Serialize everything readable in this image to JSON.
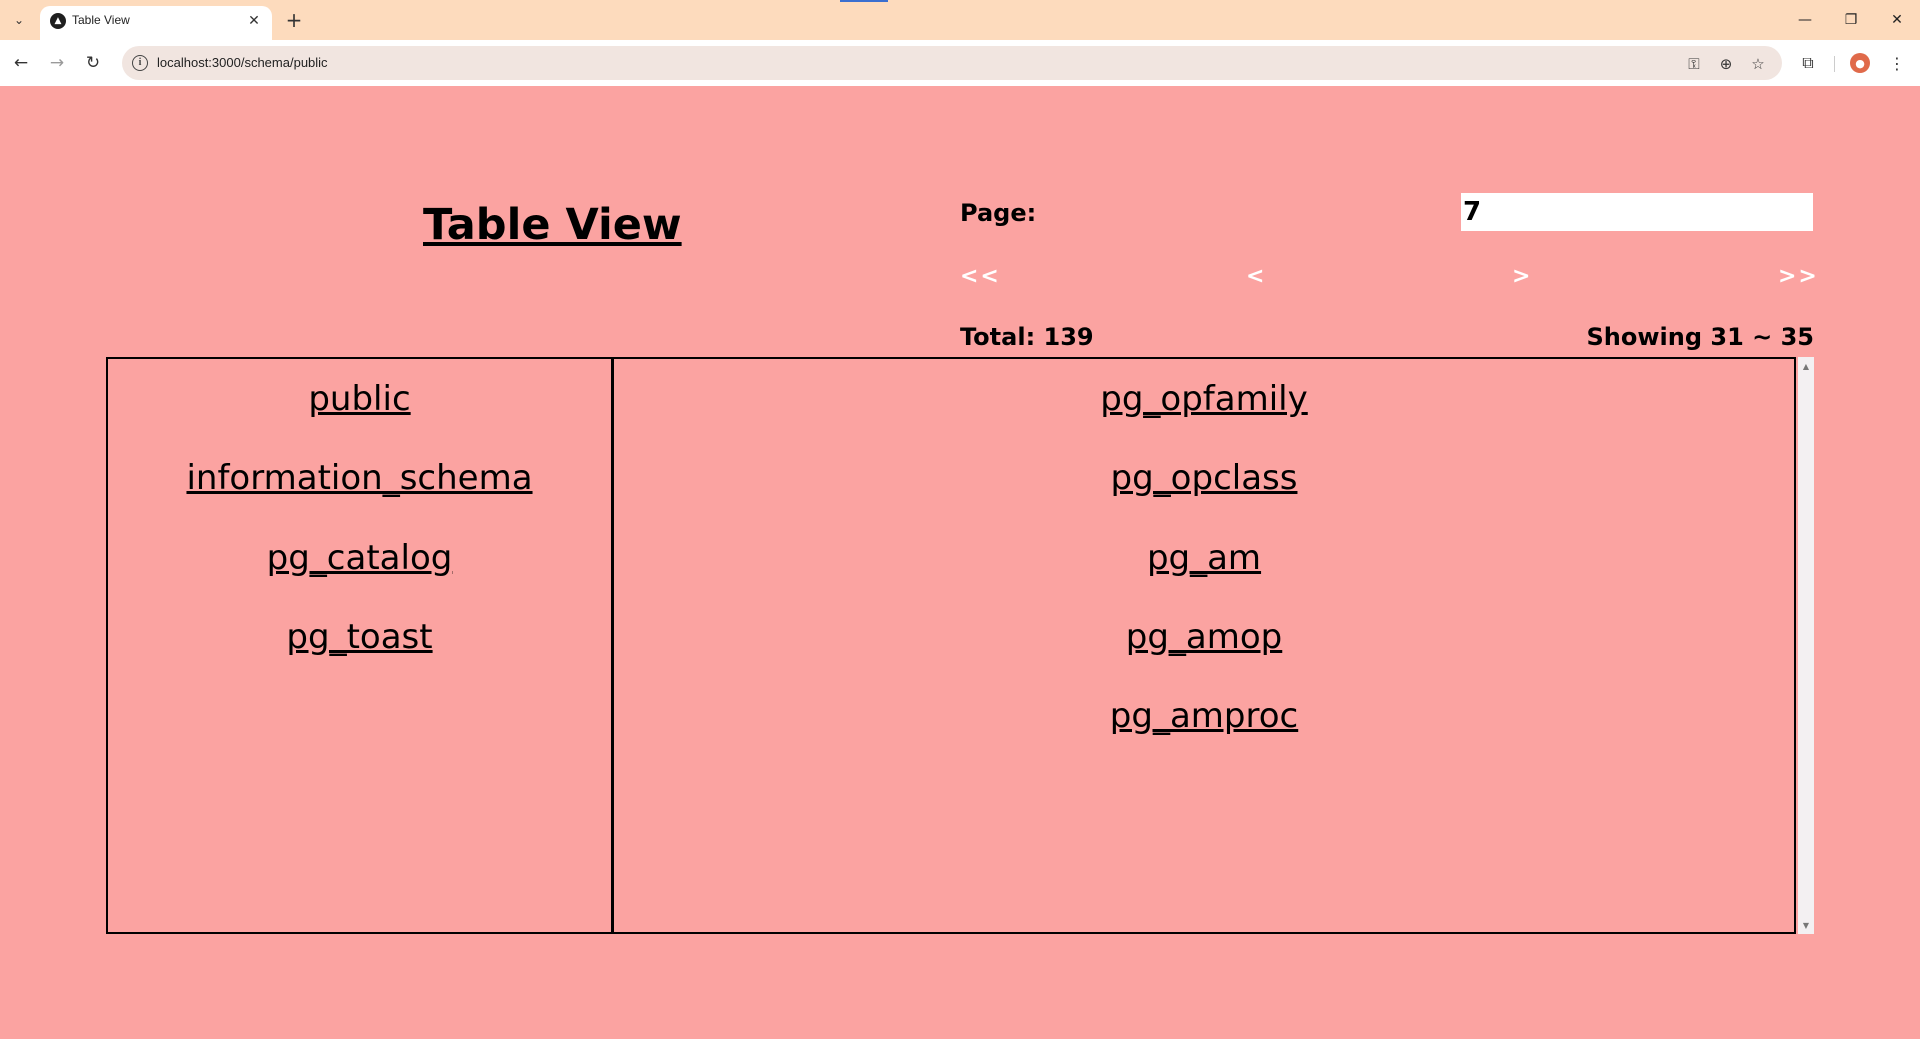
{
  "browser": {
    "tab_title": "Table View",
    "url": "localhost:3000/schema/public",
    "new_tab_glyph": "+",
    "close_glyph": "✕"
  },
  "page": {
    "title": "Table View",
    "page_label": "Page:",
    "page_value": "7",
    "pager": {
      "first": "<<",
      "prev": "<",
      "next": ">",
      "last": ">>"
    },
    "total_label": "Total: 139",
    "showing_label": "Showing 31 ~ 35"
  },
  "schemas": [
    "public",
    "information_schema",
    "pg_catalog",
    "pg_toast"
  ],
  "tables": [
    "pg_opfamily",
    "pg_opclass",
    "pg_am",
    "pg_amop",
    "pg_amproc"
  ],
  "colors": {
    "page_background": "#fba3a1",
    "tabstrip": "#fddbbd",
    "pager_text": "#ffffff"
  }
}
